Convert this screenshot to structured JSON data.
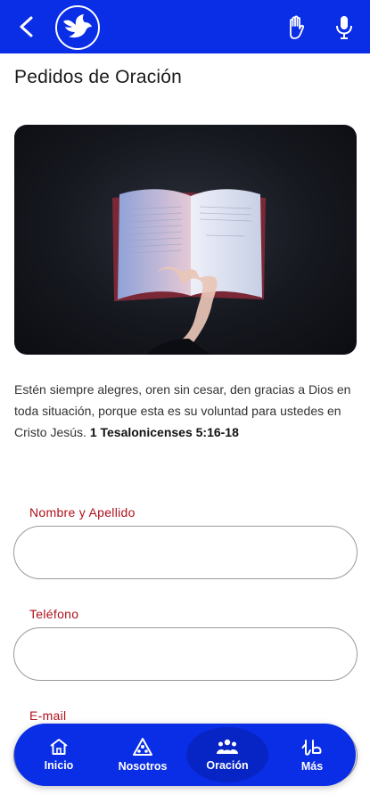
{
  "header": {
    "back_icon": "chevron-left-icon",
    "logo_icon": "dove-icon",
    "actions": [
      {
        "name": "prayer-hand-icon"
      },
      {
        "name": "microphone-icon"
      }
    ],
    "brand_color": "#0a2de6"
  },
  "page": {
    "title": "Pedidos de Oración"
  },
  "hero": {
    "image": "hand-holding-open-bible-photo"
  },
  "verse": {
    "text": "Estén siempre alegres, oren sin cesar, den gracias a Dios en toda situación, porque esta es su voluntad para ustedes en Cristo Jesús. ",
    "reference": "1 Tesalonicenses 5:16-18"
  },
  "form": {
    "fields": [
      {
        "label": "Nombre y Apellido",
        "value": ""
      },
      {
        "label": "Teléfono",
        "value": ""
      },
      {
        "label": "E-mail",
        "value": ""
      }
    ],
    "label_color": "#b0101a"
  },
  "bottom_nav": {
    "items": [
      {
        "label": "Inicio",
        "icon": "home-icon"
      },
      {
        "label": "Nosotros",
        "icon": "community-icon"
      },
      {
        "label": "Oración",
        "icon": "people-group-icon",
        "active": true
      },
      {
        "label": "Más",
        "icon": "more-hands-icon"
      }
    ]
  }
}
